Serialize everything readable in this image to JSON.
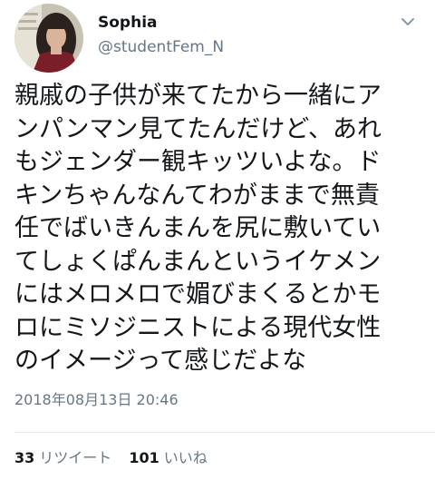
{
  "user": {
    "display_name": "Sophia",
    "handle": "@studentFem_N"
  },
  "tweet": {
    "lines": [
      "親戚の子供が来てたから一緒にア",
      "ンパンマン見てたんだけど、あれ",
      "もジェンダー観キッツいよな。ド",
      "キンちゃんなんてわがままで無責",
      "任でばいきんまんを尻に敷いてい",
      "てしょくぱんまんというイケメン",
      "にはメロメロで媚びまくるとかモ",
      "ロにミソジニストによる現代女性",
      "のイメージって感じだよな"
    ],
    "timestamp": "2018年08月13日 20:46"
  },
  "stats": {
    "retweets_count": "33",
    "retweets_label": "リツイート",
    "likes_count": "101",
    "likes_label": "いいね"
  },
  "icons": {
    "menu": "chevron-down-icon",
    "avatar": "profile-photo"
  },
  "colors": {
    "text_primary": "#14171a",
    "text_secondary": "#657786",
    "divider": "#e1e8ed",
    "background": "#ffffff"
  }
}
